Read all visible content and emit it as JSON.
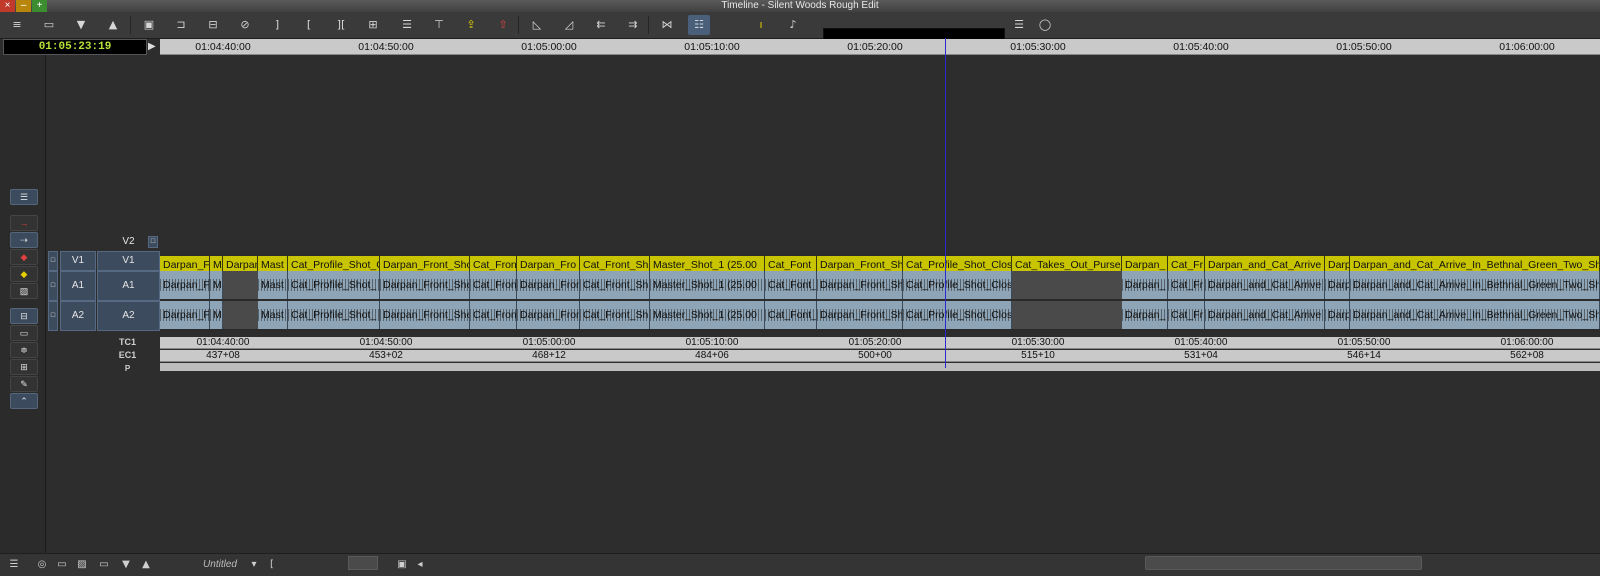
{
  "window": {
    "title": "Timeline - Silent Woods Rough Edit",
    "close": "×",
    "minimize": "–",
    "maximize": "+"
  },
  "timecode": "01:05:23:19",
  "ruler_ticks": [
    "01:04:40:00",
    "01:04:50:00",
    "01:05:00:00",
    "01:05:10:00",
    "01:05:20:00",
    "01:05:30:00",
    "01:05:40:00",
    "01:05:50:00",
    "01:06:00:00"
  ],
  "tracks": {
    "v2": {
      "label": "V2"
    },
    "v1": {
      "source": "V1",
      "record": "V1"
    },
    "a1": {
      "source": "A1",
      "record": "A1"
    },
    "a2": {
      "source": "A2",
      "record": "A2"
    },
    "tc1": {
      "label": "TC1"
    },
    "ec1": {
      "label": "EC1"
    },
    "p": {
      "label": "P"
    }
  },
  "video_clips": [
    "Darpan_Fron",
    "M",
    "Darpan",
    "Mast",
    "Cat_Profile_Shot_C",
    "Darpan_Front_Sho",
    "Cat_Fron",
    "Darpan_Fro",
    "Cat_Front_Sh",
    "Master_Shot_1 (25.00",
    "Cat_Font",
    "Darpan_Front_Sh",
    "Cat_Profile_Shot_Clos",
    "Cat_Takes_Out_Purse_",
    "Darpan_",
    "Cat_Fr",
    "Darpan_and_Cat_Arrive",
    "Darp",
    "Darpan_and_Cat_Arrive_In_Bethnal_Green_Two_Sho"
  ],
  "audio_clips": [
    "Darpan_Fron",
    "M",
    "",
    "Mast",
    "Cat_Profile_Shot_",
    "Darpan_Front_She",
    "Cat_Fron",
    "Darpan_Fron",
    "Cat_Front_Sh",
    "Master_Shot_1 (25.00",
    "Cat_Font_",
    "Darpan_Front_Sh",
    "Cat_Profile_Shot_Clos",
    "",
    "Darpan_",
    "Cat_Fr",
    "Darpan_and_Cat_Arrive",
    "Darp",
    "Darpan_and_Cat_Arrive_In_Bethnal_Green_Two_She"
  ],
  "tc1_ticks": [
    "01:04:40:00",
    "01:04:50:00",
    "01:05:00:00",
    "01:05:10:00",
    "01:05:20:00",
    "01:05:30:00",
    "01:05:40:00",
    "01:05:50:00",
    "01:06:00:00"
  ],
  "ec1_ticks": [
    "437+08",
    "453+02",
    "468+12",
    "484+06",
    "500+00",
    "515+10",
    "531+04",
    "546+14",
    "562+08"
  ],
  "bottom": {
    "sequence_name": "Untitled"
  },
  "colors": {
    "video_clip": "#c8c400",
    "audio_clip": "#8ea5b7",
    "playhead": "#2a2acf",
    "timecode_text": "#b6e23a"
  }
}
